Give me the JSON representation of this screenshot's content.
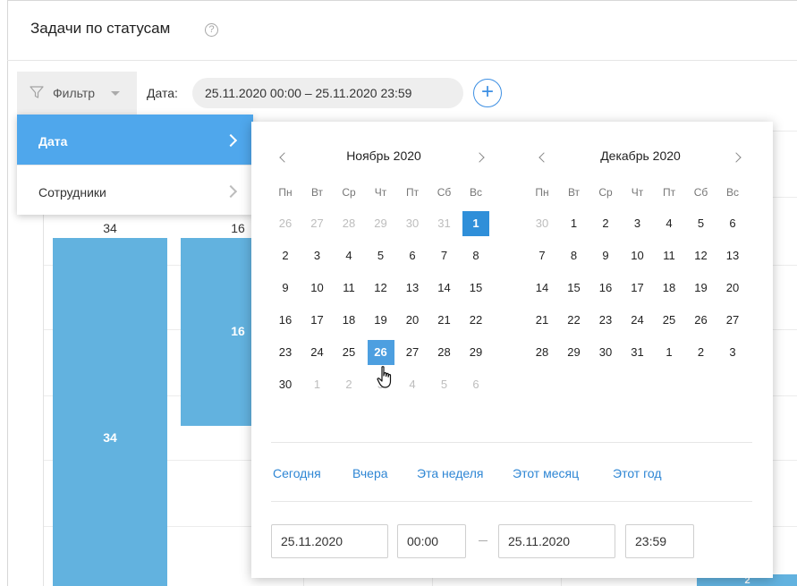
{
  "header": {
    "title": "Задачи по статусам",
    "help_icon": "?"
  },
  "toolbar": {
    "filter_label": "Фильтр",
    "date_label": "Дата:",
    "date_range": "25.11.2020 00:00 – 25.11.2020 23:59",
    "add_symbol": "+"
  },
  "filter_menu": {
    "items": [
      {
        "label": "Дата",
        "active": true
      },
      {
        "label": "Сотрудники",
        "active": false
      }
    ]
  },
  "chart": {
    "bars": [
      {
        "top_label": "34",
        "mid_label": "34"
      },
      {
        "top_label": "16",
        "mid_label": "16"
      },
      {
        "top_label": "",
        "mid_label": "2"
      }
    ]
  },
  "calendar": {
    "weekdays": [
      "Пн",
      "Вт",
      "Ср",
      "Чт",
      "Пт",
      "Сб",
      "Вс"
    ],
    "months": [
      {
        "title": "Ноябрь 2020",
        "weeks": [
          [
            "26",
            "27",
            "28",
            "29",
            "30",
            "31",
            "1"
          ],
          [
            "2",
            "3",
            "4",
            "5",
            "6",
            "7",
            "8"
          ],
          [
            "9",
            "10",
            "11",
            "12",
            "13",
            "14",
            "15"
          ],
          [
            "16",
            "17",
            "18",
            "19",
            "20",
            "21",
            "22"
          ],
          [
            "23",
            "24",
            "25",
            "26",
            "27",
            "28",
            "29"
          ],
          [
            "30",
            "1",
            "2",
            "3",
            "4",
            "5",
            "6"
          ]
        ],
        "leading_muted": 6,
        "trailing_muted": 6,
        "selected": "1",
        "hovered": "26"
      },
      {
        "title": "Декабрь 2020",
        "weeks": [
          [
            "30",
            "1",
            "2",
            "3",
            "4",
            "5",
            "6"
          ],
          [
            "7",
            "8",
            "9",
            "10",
            "11",
            "12",
            "13"
          ],
          [
            "14",
            "15",
            "16",
            "17",
            "18",
            "19",
            "20"
          ],
          [
            "21",
            "22",
            "23",
            "24",
            "25",
            "26",
            "27"
          ],
          [
            "28",
            "29",
            "30",
            "31",
            "1",
            "2",
            "3"
          ]
        ],
        "leading_muted": 1,
        "trailing_muted": 0
      }
    ],
    "quick_ranges": [
      "Сегодня",
      "Вчера",
      "Эта неделя",
      "Этот месяц",
      "Этот год"
    ],
    "start_date": "25.11.2020",
    "start_time": "00:00",
    "end_date": "25.11.2020",
    "end_time": "23:59"
  }
}
